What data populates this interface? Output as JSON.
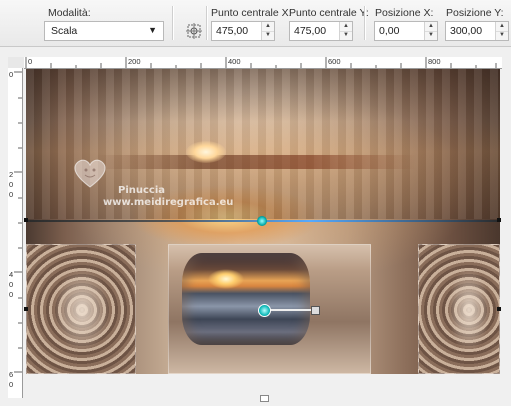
{
  "toolbar": {
    "mode_label": "Modalità:",
    "mode_value": "Scala",
    "center_x_label": "Punto centrale X:",
    "center_x_value": "475,00",
    "center_y_label": "Punto centrale Y:",
    "center_y_value": "475,00",
    "pos_x_label": "Posizione X:",
    "pos_x_value": "0,00",
    "pos_y_label": "Posizione Y:",
    "pos_y_value": "300,00"
  },
  "ruler": {
    "h_ticks": [
      "0",
      "200",
      "400",
      "600",
      "800"
    ],
    "v_ticks": [
      "0",
      "2",
      "0",
      "0",
      "4",
      "0",
      "0",
      "6",
      "0"
    ]
  },
  "watermark": {
    "line1": "Pinuccia",
    "line2": "www.meidiregrafica.eu"
  },
  "icons": {
    "pick_icon": "crosshair-grid-icon",
    "spin_up": "chevron-up-icon",
    "spin_down": "chevron-down-icon",
    "dropdown": "chevron-down-icon",
    "watermark": "heart-logo-icon"
  }
}
